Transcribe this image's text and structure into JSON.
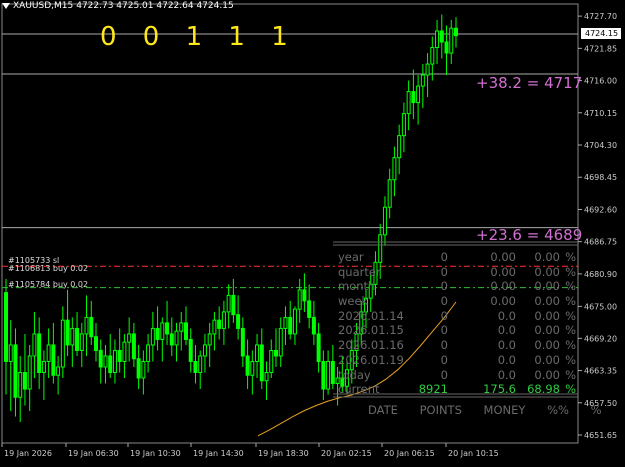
{
  "header": {
    "symbol_tf": "XAUUSD,M15",
    "ohlc": "4722.73 4725.01 4722.64 4724.15"
  },
  "counter": "0 0 1 1 1",
  "price_tag": "4724.15",
  "fib_levels": [
    {
      "label": "+38.2  = 4717",
      "price": 4717.2
    },
    {
      "label": "+23.6  = 4689",
      "price": 4689.3
    }
  ],
  "orders": [
    {
      "label": "#1105733 sl",
      "color": "#ff3030",
      "price": 4682.3
    },
    {
      "label": "#1106813 buy 0.02",
      "color": "#ff3030",
      "price": 4682.3
    },
    {
      "label": "#1105784 buy 0.02",
      "color": "#30c030",
      "price": 4678.4
    }
  ],
  "stats": {
    "rows": [
      {
        "label": "year",
        "points": "0",
        "money": "0.00",
        "pct": "0.00",
        "unit": "%"
      },
      {
        "label": "quarter",
        "points": "0",
        "money": "0.00",
        "pct": "0.00",
        "unit": "%"
      },
      {
        "label": "month",
        "points": "0",
        "money": "0.00",
        "pct": "0.00",
        "unit": "%"
      },
      {
        "label": "week",
        "points": "0",
        "money": "0.00",
        "pct": "0.00",
        "unit": "%"
      },
      {
        "label": "2026.01.14",
        "points": "0",
        "money": "0.0",
        "pct": "0.00",
        "unit": "%"
      },
      {
        "label": "2026.01.15",
        "points": "0",
        "money": "0.0",
        "pct": "0.00",
        "unit": "%"
      },
      {
        "label": "2026.01.16",
        "points": "0",
        "money": "0.0",
        "pct": "0.00",
        "unit": "%"
      },
      {
        "label": "2026.01.19",
        "points": "0",
        "money": "0.0",
        "pct": "0.00",
        "unit": "%"
      },
      {
        "label": "today",
        "points": "0",
        "money": "0.0",
        "pct": "0.00",
        "unit": "%"
      },
      {
        "label": "current",
        "points": "8921",
        "money": "175.6",
        "pct": "68.98",
        "unit": "%"
      }
    ],
    "footer": [
      "DATE",
      "POINTS",
      "MONEY",
      "%%",
      "%"
    ]
  },
  "colors": {
    "bull": "#00ff00",
    "equity_line": "#e8a020",
    "fib": "#d070d0",
    "digits": "#ffe81a"
  },
  "chart_data": {
    "type": "candlestick",
    "symbol": "XAUUSD",
    "timeframe": "M15",
    "y_ticks": [
      4727.7,
      4721.85,
      4716.0,
      4710.15,
      4704.3,
      4698.45,
      4692.6,
      4686.75,
      4680.9,
      4675.0,
      4669.2,
      4663.35,
      4657.5,
      4651.65
    ],
    "ylim": [
      4650.2,
      4729.9
    ],
    "x_ticks": [
      "19 Jan 2026",
      "19 Jan 06:30",
      "19 Jan 10:30",
      "19 Jan 14:30",
      "19 Jan 18:30",
      "20 Jan 02:15",
      "20 Jan 06:15",
      "20 Jan 10:15"
    ],
    "candles": [
      [
        4677.5,
        4680.0,
        4659.0,
        4665.0
      ],
      [
        4665.0,
        4672.5,
        4656.0,
        4668.0
      ],
      [
        4668.0,
        4671.0,
        4655.0,
        4658.5
      ],
      [
        4658.5,
        4666.0,
        4654.0,
        4663.0
      ],
      [
        4663.0,
        4670.0,
        4657.0,
        4660.0
      ],
      [
        4660.0,
        4668.0,
        4656.0,
        4666.0
      ],
      [
        4666.0,
        4674.0,
        4662.0,
        4670.0
      ],
      [
        4670.0,
        4673.0,
        4660.0,
        4663.0
      ],
      [
        4663.0,
        4667.0,
        4658.0,
        4665.0
      ],
      [
        4665.0,
        4671.0,
        4662.0,
        4668.0
      ],
      [
        4668.0,
        4672.0,
        4661.0,
        4662.5
      ],
      [
        4662.5,
        4666.0,
        4659.0,
        4664.0
      ],
      [
        4664.0,
        4675.0,
        4662.0,
        4672.5
      ],
      [
        4672.5,
        4678.0,
        4666.0,
        4668.0
      ],
      [
        4668.0,
        4673.0,
        4664.0,
        4671.0
      ],
      [
        4671.0,
        4674.0,
        4666.0,
        4667.0
      ],
      [
        4667.0,
        4672.0,
        4664.0,
        4670.0
      ],
      [
        4670.0,
        4677.0,
        4666.0,
        4673.0
      ],
      [
        4673.0,
        4676.0,
        4668.0,
        4669.5
      ],
      [
        4669.5,
        4672.0,
        4665.0,
        4667.0
      ],
      [
        4667.0,
        4669.0,
        4661.0,
        4664.0
      ],
      [
        4664.0,
        4668.0,
        4661.0,
        4666.0
      ],
      [
        4666.0,
        4670.0,
        4662.0,
        4663.0
      ],
      [
        4663.0,
        4669.0,
        4661.0,
        4667.0
      ],
      [
        4667.0,
        4671.0,
        4663.0,
        4665.0
      ],
      [
        4665.0,
        4670.0,
        4662.0,
        4668.5
      ],
      [
        4668.5,
        4673.0,
        4665.0,
        4670.0
      ],
      [
        4670.0,
        4672.0,
        4664.0,
        4665.5
      ],
      [
        4665.5,
        4668.0,
        4660.0,
        4662.0
      ],
      [
        4662.0,
        4667.0,
        4659.0,
        4665.0
      ],
      [
        4665.0,
        4670.0,
        4663.0,
        4668.0
      ],
      [
        4668.0,
        4674.0,
        4665.0,
        4671.0
      ],
      [
        4671.0,
        4675.0,
        4667.0,
        4669.0
      ],
      [
        4669.0,
        4673.0,
        4665.0,
        4672.0
      ],
      [
        4672.0,
        4676.0,
        4668.0,
        4670.0
      ],
      [
        4670.0,
        4673.0,
        4666.0,
        4668.0
      ],
      [
        4668.0,
        4672.0,
        4665.0,
        4670.5
      ],
      [
        4670.5,
        4674.0,
        4667.0,
        4672.0
      ],
      [
        4672.0,
        4675.0,
        4668.0,
        4669.0
      ],
      [
        4669.0,
        4671.0,
        4663.0,
        4665.0
      ],
      [
        4665.0,
        4668.0,
        4661.0,
        4663.0
      ],
      [
        4663.0,
        4667.0,
        4660.0,
        4666.0
      ],
      [
        4666.0,
        4670.0,
        4663.0,
        4668.0
      ],
      [
        4668.0,
        4672.0,
        4664.0,
        4670.0
      ],
      [
        4670.0,
        4674.0,
        4667.0,
        4672.5
      ],
      [
        4672.5,
        4675.0,
        4669.0,
        4671.0
      ],
      [
        4671.0,
        4676.0,
        4668.0,
        4674.0
      ],
      [
        4674.0,
        4679.0,
        4671.0,
        4677.0
      ],
      [
        4677.0,
        4680.0,
        4672.0,
        4673.5
      ],
      [
        4673.5,
        4677.0,
        4669.0,
        4671.0
      ],
      [
        4671.0,
        4673.0,
        4664.0,
        4666.0
      ],
      [
        4666.0,
        4669.0,
        4660.0,
        4662.5
      ],
      [
        4662.5,
        4667.0,
        4659.0,
        4665.0
      ],
      [
        4665.0,
        4670.0,
        4662.0,
        4668.0
      ],
      [
        4668.0,
        4671.0,
        4660.0,
        4661.5
      ],
      [
        4661.5,
        4665.0,
        4658.0,
        4663.0
      ],
      [
        4663.0,
        4669.0,
        4662.0,
        4667.0
      ],
      [
        4667.0,
        4671.0,
        4664.0,
        4666.0
      ],
      [
        4666.0,
        4673.0,
        4664.0,
        4671.0
      ],
      [
        4671.0,
        4675.0,
        4668.0,
        4673.0
      ],
      [
        4673.0,
        4676.0,
        4669.0,
        4670.0
      ],
      [
        4670.0,
        4675.0,
        4668.0,
        4674.5
      ],
      [
        4674.5,
        4680.0,
        4672.0,
        4678.0
      ],
      [
        4678.0,
        4681.0,
        4674.0,
        4676.0
      ],
      [
        4676.0,
        4679.0,
        4671.0,
        4673.0
      ],
      [
        4673.0,
        4676.0,
        4668.0,
        4670.0
      ],
      [
        4670.0,
        4672.0,
        4663.0,
        4665.0
      ],
      [
        4665.0,
        4667.0,
        4658.0,
        4660.0
      ],
      [
        4660.0,
        4667.0,
        4659.0,
        4665.0
      ],
      [
        4665.0,
        4668.0,
        4660.0,
        4661.0
      ],
      [
        4661.0,
        4664.0,
        4657.0,
        4662.0
      ],
      [
        4662.0,
        4666.0,
        4659.5,
        4660.5
      ],
      [
        4660.5,
        4665.0,
        4659.0,
        4663.5
      ],
      [
        4663.5,
        4669.0,
        4661.0,
        4667.0
      ],
      [
        4667.0,
        4672.0,
        4664.0,
        4670.0
      ],
      [
        4670.0,
        4676.0,
        4668.0,
        4674.0
      ],
      [
        4674.0,
        4678.0,
        4671.0,
        4676.5
      ],
      [
        4676.5,
        4681.0,
        4674.0,
        4679.0
      ],
      [
        4679.0,
        4685.0,
        4677.0,
        4683.0
      ],
      [
        4683.0,
        4690.0,
        4680.0,
        4688.0
      ],
      [
        4688.0,
        4695.0,
        4686.0,
        4693.0
      ],
      [
        4693.0,
        4700.0,
        4691.0,
        4698.0
      ],
      [
        4698.0,
        4704.0,
        4695.0,
        4702.0
      ],
      [
        4702.0,
        4708.0,
        4699.0,
        4706.0
      ],
      [
        4706.0,
        4712.0,
        4703.0,
        4710.0
      ],
      [
        4710.0,
        4716.0,
        4707.0,
        4714.0
      ],
      [
        4714.0,
        4718.0,
        4709.0,
        4712.0
      ],
      [
        4712.0,
        4717.0,
        4708.0,
        4715.0
      ],
      [
        4715.0,
        4719.0,
        4711.0,
        4717.0
      ],
      [
        4717.0,
        4721.0,
        4713.0,
        4719.0
      ],
      [
        4719.0,
        4724.0,
        4716.0,
        4722.0
      ],
      [
        4722.0,
        4727.0,
        4719.0,
        4725.0
      ],
      [
        4725.0,
        4728.0,
        4720.0,
        4723.0
      ],
      [
        4723.0,
        4726.0,
        4717.0,
        4721.0
      ],
      [
        4721.0,
        4727.0,
        4719.0,
        4725.5
      ],
      [
        4725.5,
        4727.5,
        4722.0,
        4724.15
      ]
    ],
    "equity_line_y": [
      4651.5,
      4652.6,
      4653.8,
      4655.0,
      4656.1,
      4657.0,
      4657.8,
      4658.4,
      4658.9,
      4659.6,
      4660.5,
      4661.8,
      4663.5,
      4665.6,
      4668.0,
      4670.5,
      4673.0,
      4675.8
    ]
  }
}
